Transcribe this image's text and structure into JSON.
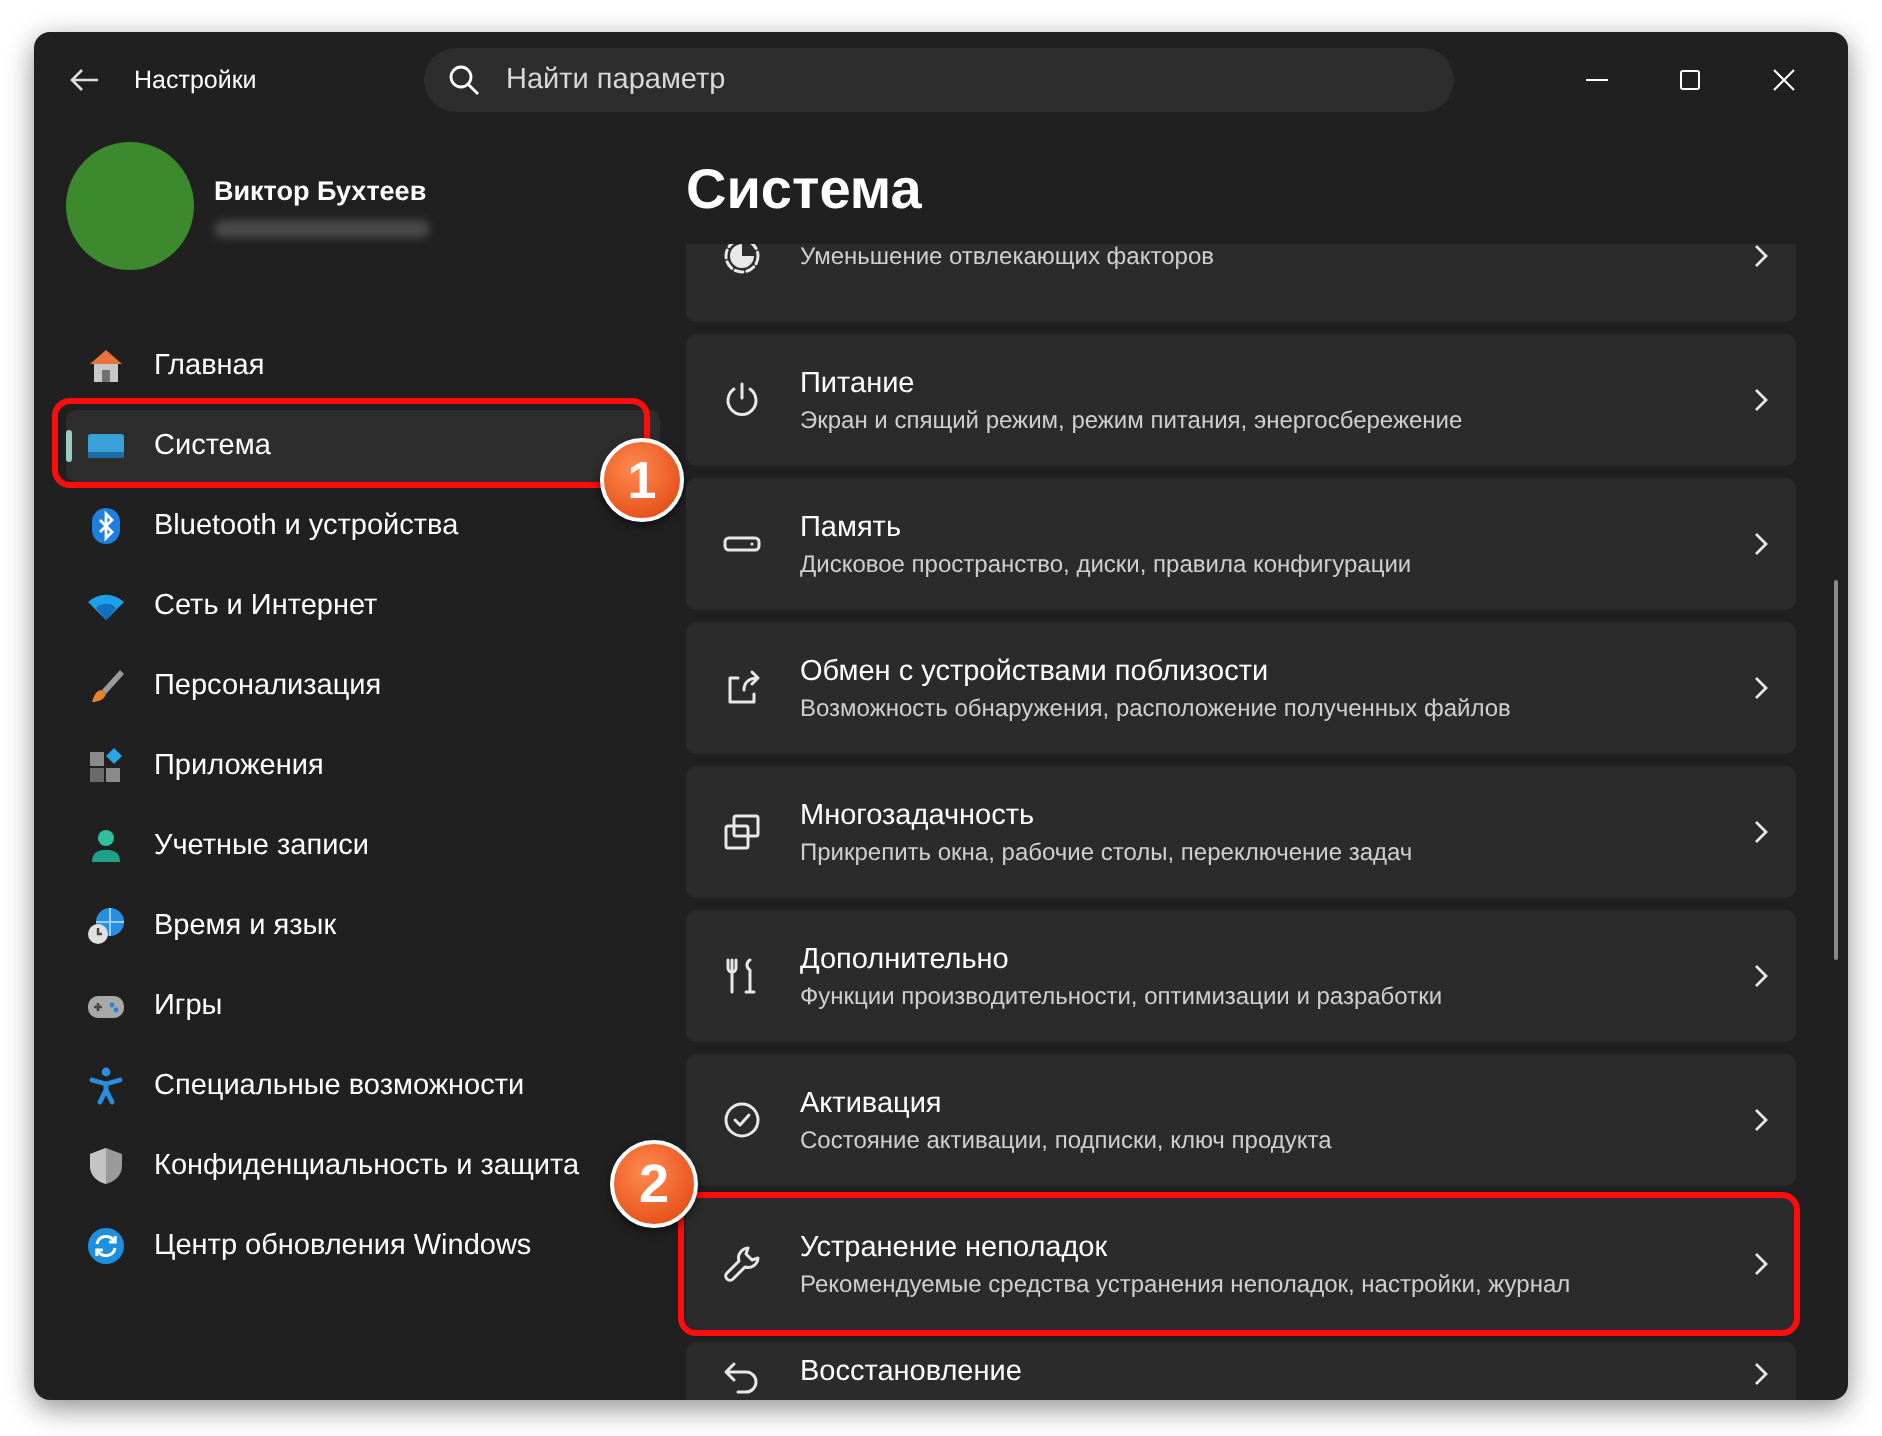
{
  "window": {
    "title": "Настройки"
  },
  "search": {
    "placeholder": "Найти параметр"
  },
  "account": {
    "name": "Виктор Бухтеев"
  },
  "sidebar": {
    "items": [
      {
        "label": "Главная",
        "kind": "home",
        "selected": false,
        "highlighted": false
      },
      {
        "label": "Система",
        "kind": "system",
        "selected": true,
        "highlighted": true,
        "callout": "1"
      },
      {
        "label": "Bluetooth и устройства",
        "kind": "bluetooth",
        "selected": false,
        "highlighted": false
      },
      {
        "label": "Сеть и Интернет",
        "kind": "network",
        "selected": false,
        "highlighted": false
      },
      {
        "label": "Персонализация",
        "kind": "brush",
        "selected": false,
        "highlighted": false
      },
      {
        "label": "Приложения",
        "kind": "apps",
        "selected": false,
        "highlighted": false
      },
      {
        "label": "Учетные записи",
        "kind": "accounts",
        "selected": false,
        "highlighted": false
      },
      {
        "label": "Время и язык",
        "kind": "time",
        "selected": false,
        "highlighted": false
      },
      {
        "label": "Игры",
        "kind": "games",
        "selected": false,
        "highlighted": false
      },
      {
        "label": "Специальные возможности",
        "kind": "accessibility",
        "selected": false,
        "highlighted": false
      },
      {
        "label": "Конфиденциальность и защита",
        "kind": "privacy",
        "selected": false,
        "highlighted": false
      },
      {
        "label": "Центр обновления Windows",
        "kind": "update",
        "selected": false,
        "highlighted": false
      }
    ]
  },
  "page": {
    "title": "Система"
  },
  "cards": [
    {
      "description": "Уменьшение отвлекающих факторов",
      "kind": "focus",
      "highlighted": false
    },
    {
      "title": "Питание",
      "description": "Экран и спящий режим, режим питания, энергосбережение",
      "kind": "power",
      "highlighted": false
    },
    {
      "title": "Память",
      "description": "Дисковое пространство, диски, правила конфигурации",
      "kind": "storage",
      "highlighted": false
    },
    {
      "title": "Обмен с устройствами поблизости",
      "description": "Возможность обнаружения, расположение полученных файлов",
      "kind": "share",
      "highlighted": false
    },
    {
      "title": "Многозадачность",
      "description": "Прикрепить окна, рабочие столы, переключение задач",
      "kind": "multitask",
      "highlighted": false
    },
    {
      "title": "Дополнительно",
      "description": "Функции производительности, оптимизации и разработки",
      "kind": "tools",
      "highlighted": false
    },
    {
      "title": "Активация",
      "description": "Состояние активации, подписки, ключ продукта",
      "kind": "activation",
      "highlighted": false
    },
    {
      "title": "Устранение неполадок",
      "description": "Рекомендуемые средства устранения неполадок, настройки, журнал",
      "kind": "troubleshoot",
      "highlighted": true,
      "callout": "2"
    },
    {
      "title": "Восстановление",
      "kind": "recovery",
      "highlighted": false
    }
  ]
}
